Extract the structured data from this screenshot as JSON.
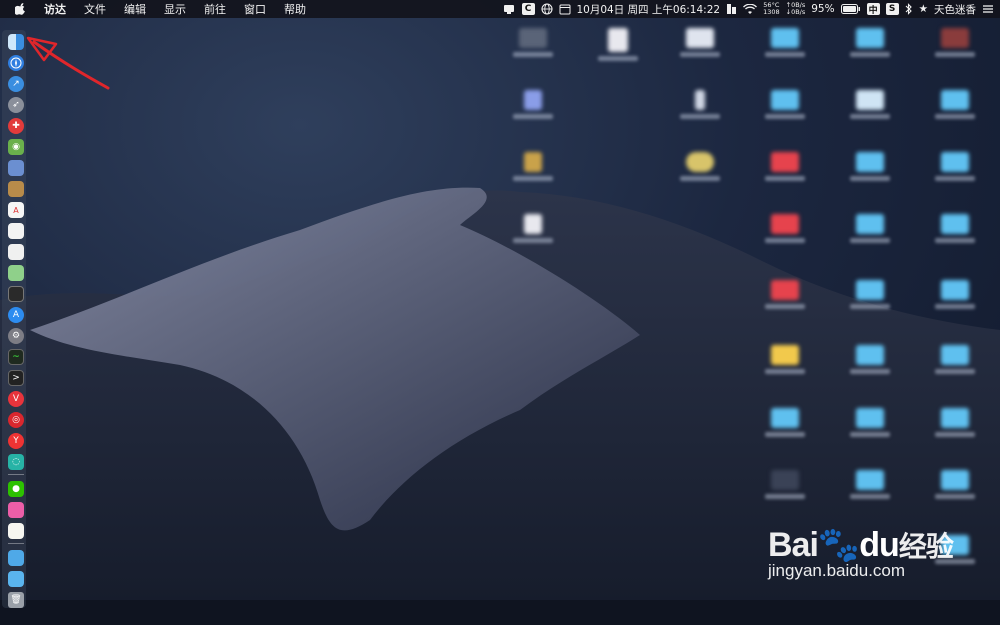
{
  "menubar": {
    "apple_icon": "apple-logo-icon",
    "app_name": "访达",
    "menus": [
      "文件",
      "编辑",
      "显示",
      "前往",
      "窗口",
      "帮助"
    ],
    "status": {
      "c_label": "C",
      "date_time": "10月04日 周四 上午06:14:22",
      "temp": "56°C",
      "fan": "1308",
      "net_up": "0B/s",
      "net_down": "0B/s",
      "battery": "95%",
      "input_method": "中",
      "s_label": "S",
      "user": "天色迷香"
    }
  },
  "dock": {
    "icons": [
      "finder-icon",
      "safari-icon",
      "compass-icon",
      "rocket-icon",
      "red-app-icon",
      "android-icon",
      "preview-icon",
      "notes-icon",
      "calendar-icon",
      "textedit-icon",
      "document-icon",
      "maps-icon",
      "terminal-icon",
      "appstore-icon",
      "system-preferences-icon",
      "activity-monitor-icon",
      "console-icon",
      "vivaldi-icon",
      "netease-music-icon",
      "yandex-icon",
      "teal-app-icon",
      "wechat-icon",
      "pink-app-icon",
      "notes2-icon",
      "folder-icon",
      "downloads-folder-icon",
      "trash-icon"
    ]
  },
  "watermark": {
    "logo_bai": "Bai",
    "logo_du": "du",
    "logo_cn": "经验",
    "url": "jingyan.baidu.com"
  },
  "colors": {
    "menubar_bg": "#14161e",
    "annotation_arrow": "#e0262b",
    "folder_blue": "#5fc0ef",
    "folder_red": "#e6434d",
    "folder_yellow": "#f2c94c"
  }
}
